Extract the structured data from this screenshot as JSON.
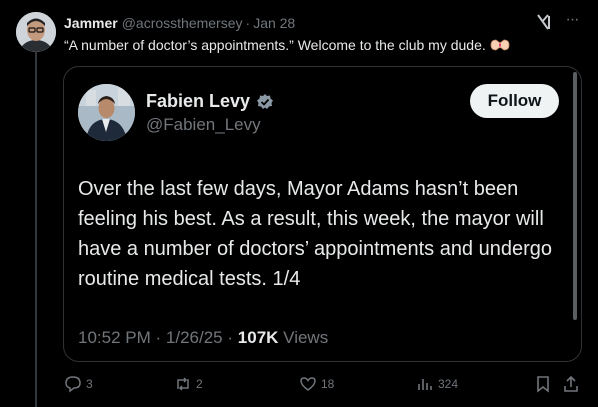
{
  "post": {
    "author_name": "Jammer",
    "author_handle": "@acrossthemersey",
    "separator": "·",
    "date": "Jan 28",
    "more": "···",
    "text": "“A number of doctor’s appointments.”  Welcome to the club my dude."
  },
  "quoted": {
    "name": "Fabien Levy",
    "handle": "@Fabien_Levy",
    "follow_label": "Follow",
    "body": "Over the last few days, Mayor Adams hasn’t been feeling his best. As a result, this week, the mayor will have a number of doctors’ appointments and undergo routine medical tests. 1/4",
    "time": "10:52 PM",
    "separator": "·",
    "date": "1/26/25",
    "views_count": "107K",
    "views_label": "Views"
  },
  "actions": {
    "replies": "3",
    "reposts": "2",
    "likes": "18",
    "views": "324"
  },
  "colors": {
    "background": "#000000",
    "text": "#e7e9ea",
    "muted": "#71767b",
    "border": "#2f3336",
    "verified": "#1d9bf0"
  },
  "icons": [
    "grok-icon",
    "more-icon",
    "heart-hands-icon",
    "verified-icon",
    "reply-icon",
    "repost-icon",
    "like-icon",
    "views-icon",
    "bookmark-icon",
    "share-icon"
  ]
}
